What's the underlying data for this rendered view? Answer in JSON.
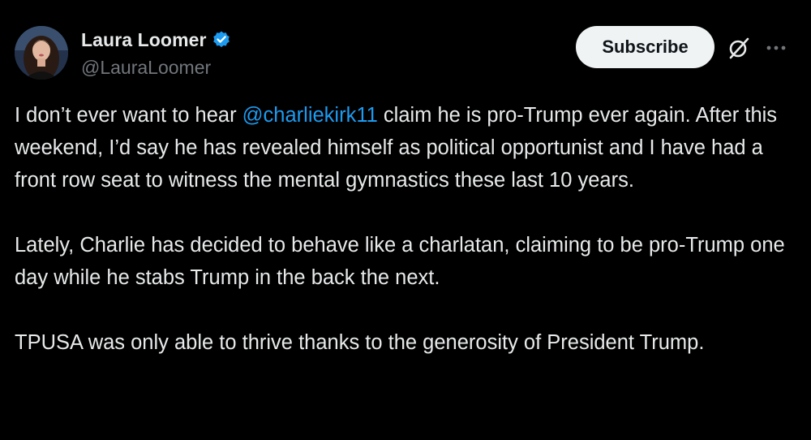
{
  "tweet": {
    "author": {
      "display_name": "Laura Loomer",
      "handle": "@LauraLoomer",
      "verified": true,
      "avatar_icon": "avatar-photo"
    },
    "actions": {
      "subscribe_label": "Subscribe",
      "grok_icon": "grok-icon",
      "more_icon": "more-options-icon"
    },
    "paragraphs": [
      {
        "before": "I don’t ever want to hear ",
        "mention": "@charliekirk11",
        "after": " claim he is pro-Trump ever again. After this weekend, I’d say he has revealed himself as political opportunist and I have had a front row seat to witness the mental gymnastics these last 10 years."
      },
      {
        "text": "Lately, Charlie has decided to behave like a charlatan, claiming to be pro-Trump one day while he stabs Trump in the back the next."
      },
      {
        "text": "TPUSA was only able to thrive thanks to the generosity of President Trump."
      }
    ]
  },
  "colors": {
    "background": "#000000",
    "text": "#e7e9ea",
    "secondary_text": "#71767b",
    "mention": "#1d9bf0",
    "verified_badge": "#1d9bf0",
    "subscribe_bg": "#eff3f4"
  }
}
